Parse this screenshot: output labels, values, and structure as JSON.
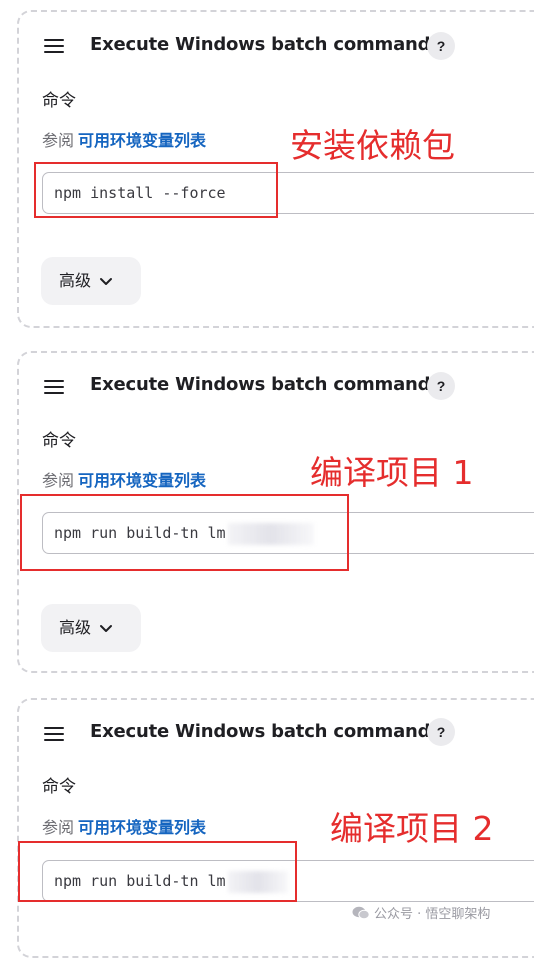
{
  "steps": [
    {
      "title": "Execute Windows batch command",
      "help": "?",
      "command_label": "命令",
      "env_prefix": "参阅",
      "env_link": "可用环境变量列表",
      "command_value": "npm install --force",
      "advanced_label": "高级",
      "annotation": "安装依赖包"
    },
    {
      "title": "Execute Windows batch command",
      "help": "?",
      "command_label": "命令",
      "env_prefix": "参阅",
      "env_link": "可用环境变量列表",
      "command_value": "npm run build-tn lm",
      "advanced_label": "高级",
      "annotation": "编译项目 1"
    },
    {
      "title": "Execute Windows batch command",
      "help": "?",
      "command_label": "命令",
      "env_prefix": "参阅",
      "env_link": "可用环境变量列表",
      "command_value": "npm run build-tn lm",
      "annotation": "编译项目 2"
    }
  ],
  "watermark": "公众号 · 悟空聊架构",
  "colors": {
    "link": "#1565c0",
    "annotation_red": "#e52d2d",
    "dashed_border": "#d3d3d8",
    "button_bg": "#f2f2f4"
  },
  "icons": [
    "menu-icon",
    "help-icon",
    "chevron-down-icon",
    "wechat-icon"
  ]
}
